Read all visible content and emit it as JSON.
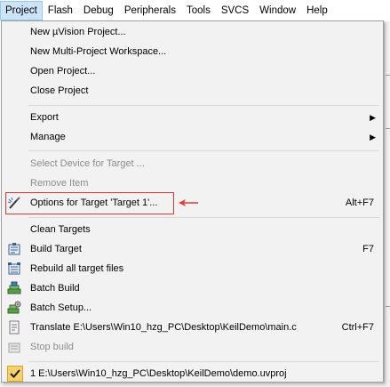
{
  "menubar": {
    "items": [
      {
        "label": "Project"
      },
      {
        "label": "Flash"
      },
      {
        "label": "Debug"
      },
      {
        "label": "Peripherals"
      },
      {
        "label": "Tools"
      },
      {
        "label": "SVCS"
      },
      {
        "label": "Window"
      },
      {
        "label": "Help"
      }
    ]
  },
  "menu": {
    "new_project": "New µVision Project...",
    "new_multi": "New Multi-Project Workspace...",
    "open_project": "Open Project...",
    "close_project": "Close Project",
    "export": "Export",
    "manage": "Manage",
    "select_device": "Select Device for Target ...",
    "remove_item": "Remove Item",
    "options_target": "Options for Target 'Target 1'...",
    "options_shortcut": "Alt+F7",
    "clean_targets": "Clean Targets",
    "build_target": "Build Target",
    "build_shortcut": "F7",
    "rebuild_all": "Rebuild all target files",
    "batch_build": "Batch Build",
    "batch_setup": "Batch Setup...",
    "translate": "Translate E:\\Users\\Win10_hzg_PC\\Desktop\\KeilDemo\\main.c",
    "translate_shortcut": "Ctrl+F7",
    "stop_build": "Stop build",
    "recent_project": "1 E:\\Users\\Win10_hzg_PC\\Desktop\\KeilDemo\\demo.uvproj"
  },
  "colors": {
    "highlight_border": "#e53935",
    "active_menu": "#cce4f7",
    "menu_bg": "#f2f2f2"
  }
}
